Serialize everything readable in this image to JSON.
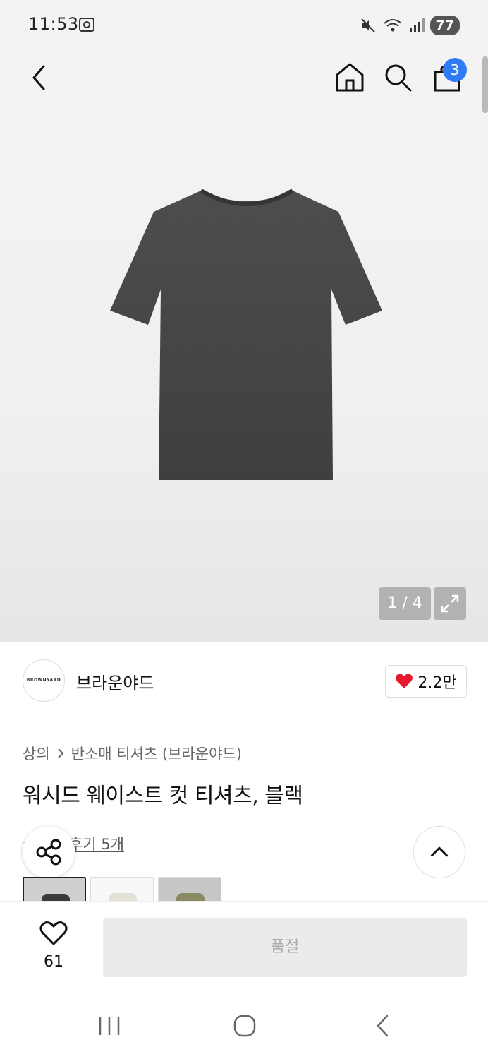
{
  "status_bar": {
    "time": "11:53",
    "battery": "77",
    "icons": [
      "screenshot-icon",
      "mute-icon",
      "wifi-icon",
      "signal-icon"
    ]
  },
  "top_nav": {
    "icons": [
      "back-icon",
      "home-icon",
      "search-icon",
      "shopping-bag-icon"
    ],
    "cart_count": "3"
  },
  "gallery": {
    "counter": "1 / 4",
    "expand_icon": "expand-icon",
    "product_color": "#4a4a4a"
  },
  "brand": {
    "logo_text": "BROWNYARD",
    "name": "브라운야드",
    "likes": "2.2만"
  },
  "breadcrumb": {
    "category": "상의",
    "subcategory": "반소매 티셔츠 (브라운야드)"
  },
  "product": {
    "title": "워시드 웨이스트 컷 티셔츠, 블랙",
    "review_text": "후기 5개"
  },
  "swatches": [
    {
      "color": "#3a3a3a",
      "bg": "#cfcfcf",
      "selected": true
    },
    {
      "color": "#e3e0d6",
      "bg": "#f8f8f8",
      "selected": false
    },
    {
      "color": "#8a8a62",
      "bg": "#c7c7c7",
      "selected": false
    }
  ],
  "bottom_bar": {
    "wish_count": "61",
    "soldout_label": "품절"
  },
  "colors": {
    "accent_badge": "#2f7bf5",
    "heart": "#e8192c"
  }
}
